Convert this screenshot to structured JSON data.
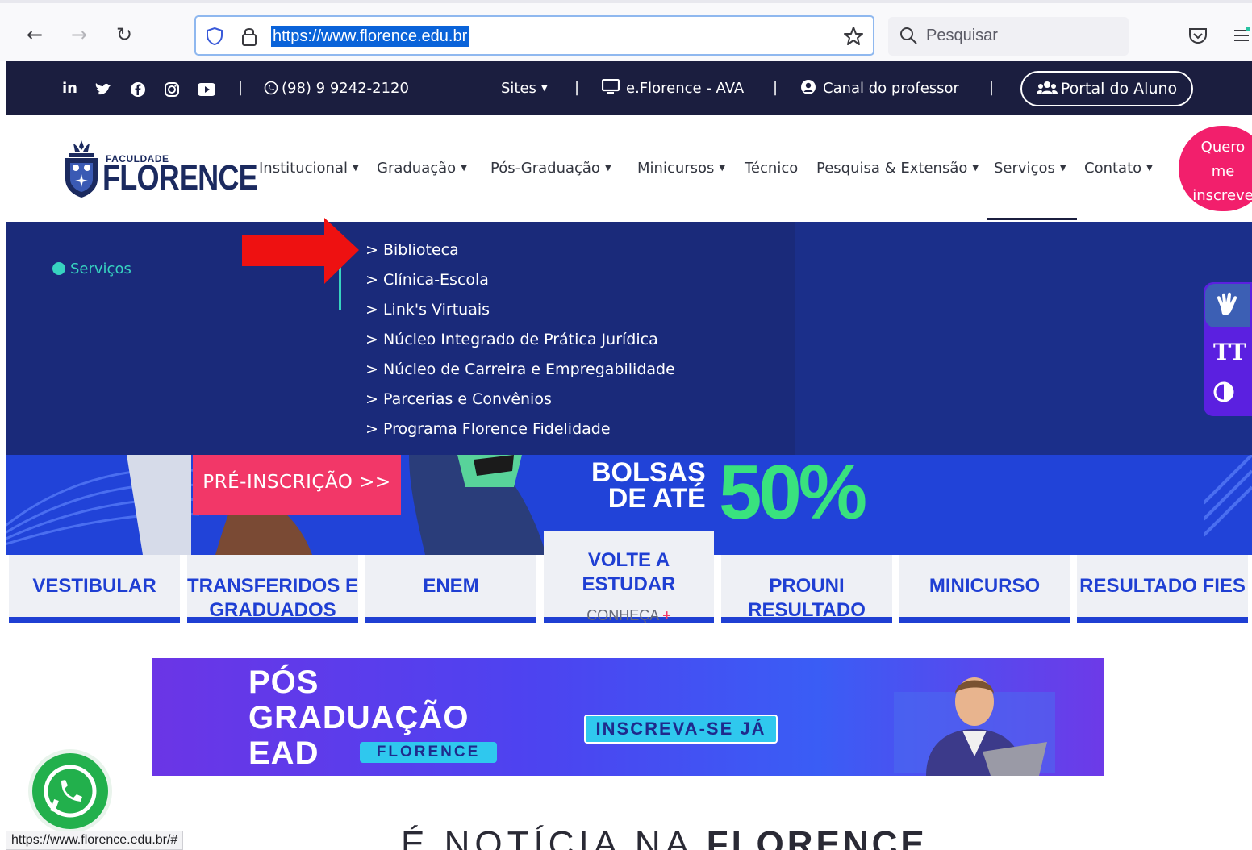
{
  "browser": {
    "url": "https://www.florence.edu.br",
    "search_placeholder": "Pesquisar",
    "status_url": "https://www.florence.edu.br/#"
  },
  "topbar": {
    "phone": "(98) 9 9242-2120",
    "sites": "Sites",
    "eflorence": "e.Florence - AVA",
    "canal": "Canal do professor",
    "portal": "Portal do Aluno",
    "separator": "|"
  },
  "logo": {
    "small": "FACULDADE",
    "big": "FLORENCE"
  },
  "nav": {
    "items": [
      {
        "label": "Institucional",
        "caret": true
      },
      {
        "label": "Graduação",
        "caret": true
      },
      {
        "label": "Pós-Graduação",
        "caret": true
      },
      {
        "label": "Minicursos",
        "caret": true
      },
      {
        "label": "Técnico",
        "caret": false
      },
      {
        "label": "Pesquisa & Extensão",
        "caret": true
      },
      {
        "label": "Serviços",
        "caret": true
      },
      {
        "label": "Contato",
        "caret": true
      }
    ],
    "cta_line1": "Quero",
    "cta_line2": "me",
    "cta_line3": "inscreve"
  },
  "dropdown": {
    "heading": "Serviços",
    "items": [
      "> Biblioteca",
      "> Clínica-Escola",
      "> Link's Virtuais",
      "> Núcleo Integrado de Prática Jurídica",
      "> Núcleo de Carreira e Empregabilidade",
      "> Parcerias e Convênios",
      "> Programa Florence Fidelidade"
    ]
  },
  "banner": {
    "pre_inscricao": "PRÉ-INSCRIÇÃO >>",
    "bolsas_line1": "BOLSAS",
    "bolsas_line2": "DE ATÉ",
    "percent": "50%"
  },
  "cards": [
    {
      "label": "VESTIBULAR"
    },
    {
      "label": "TRANSFERIDOS E GRADUADOS"
    },
    {
      "label": "ENEM"
    },
    {
      "label": "VOLTE A ESTUDAR",
      "sub": "CONHEÇA",
      "plus": "+"
    },
    {
      "label": "PROUNI RESULTADO"
    },
    {
      "label": "MINICURSO"
    },
    {
      "label": "RESULTADO FIES"
    }
  ],
  "pos_banner": {
    "line1": "PÓS",
    "line2": "GRADUAÇÃO",
    "line3": "EAD",
    "tag": "FLORENCE",
    "inscreva": "INSCREVA-SE JÁ"
  },
  "news": {
    "prefix": "É NOTÍCIA NA ",
    "brand": "FLORENCE"
  },
  "accessibility": {
    "font_label": "TT"
  },
  "colors": {
    "topbar": "#1b1e3f",
    "dropdown": "#1a2a7a",
    "accent_pink": "#f23768",
    "accent_teal": "#37d3c0",
    "card_blue": "#1f3fd3"
  }
}
